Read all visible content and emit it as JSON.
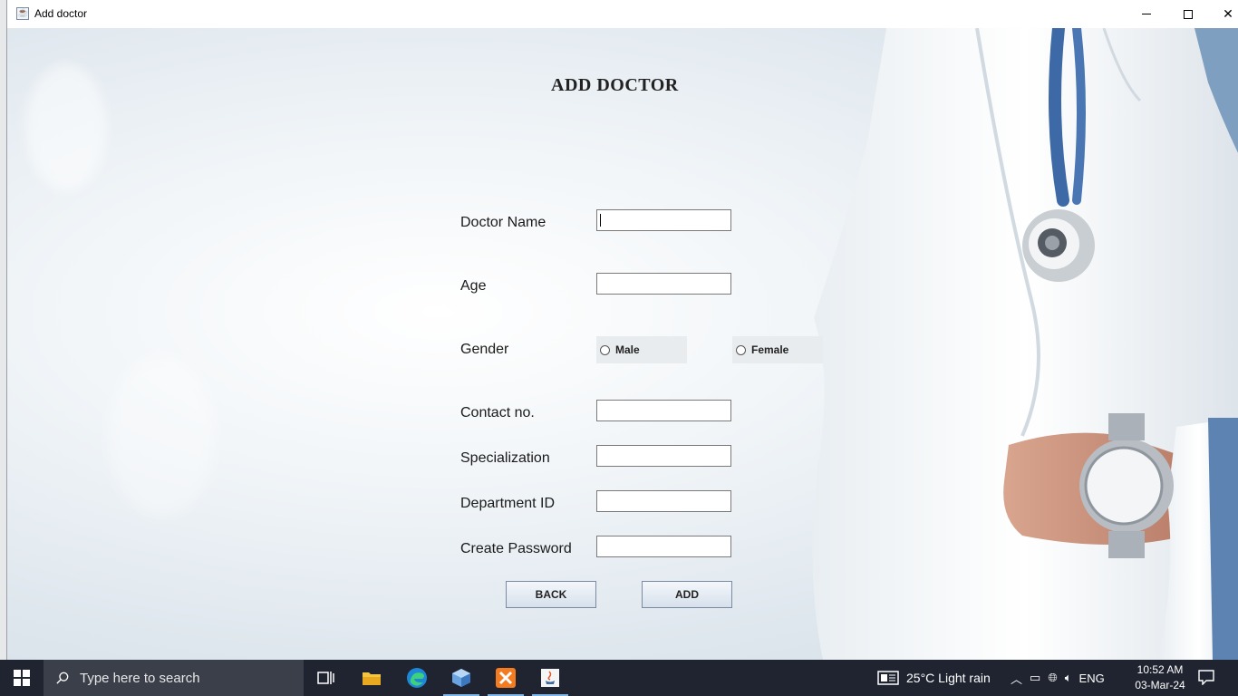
{
  "window": {
    "title": "Add doctor"
  },
  "form": {
    "heading": "ADD DOCTOR",
    "fields": [
      {
        "label": "Doctor Name",
        "value": ""
      },
      {
        "label": "Age",
        "value": ""
      },
      {
        "label": "Contact no.",
        "value": ""
      },
      {
        "label": "Specialization",
        "value": ""
      },
      {
        "label": "Department ID",
        "value": ""
      },
      {
        "label": "Create Password",
        "value": ""
      }
    ],
    "gender_label": "Gender",
    "gender_options": [
      "Male",
      "Female"
    ],
    "back_label": "BACK",
    "add_label": "ADD"
  },
  "taskbar": {
    "search_placeholder": "Type here to search",
    "weather": "25°C  Light rain",
    "language": "ENG",
    "time": "10:52 AM",
    "date": "03-Mar-24",
    "icons": [
      "task-view-icon",
      "file-explorer-icon",
      "edge-icon",
      "box-app-icon",
      "xampp-icon",
      "java-icon"
    ]
  },
  "colors": {
    "taskbar": "#1f2430",
    "accent": "#7fb6ea",
    "button_gradient_top": "#f4f7fb",
    "button_gradient_bottom": "#d6e0ec"
  }
}
